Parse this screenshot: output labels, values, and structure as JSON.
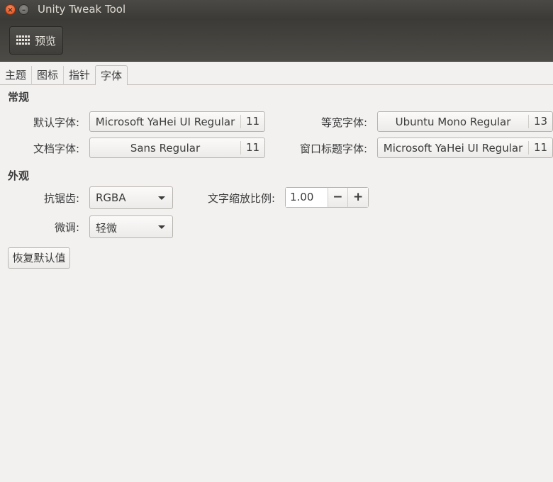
{
  "window": {
    "title": "Unity Tweak Tool",
    "close_glyph": "×",
    "minimize_glyph": "–"
  },
  "toolbar": {
    "preview_label": "预览",
    "preview_icon": "grid-icon"
  },
  "tabs": [
    {
      "label": "主题",
      "active": false
    },
    {
      "label": "图标",
      "active": false
    },
    {
      "label": "指针",
      "active": false
    },
    {
      "label": "字体",
      "active": true
    }
  ],
  "general": {
    "title": "常规",
    "default_font": {
      "label": "默认字体:",
      "name": "Microsoft YaHei UI Regular",
      "size": "11"
    },
    "monospace_font": {
      "label": "等宽字体:",
      "name": "Ubuntu Mono Regular",
      "size": "13"
    },
    "document_font": {
      "label": "文档字体:",
      "name": "Sans Regular",
      "size": "11"
    },
    "window_title_font": {
      "label": "窗口标题字体:",
      "name": "Microsoft YaHei UI Regular",
      "size": "11"
    }
  },
  "appearance": {
    "title": "外观",
    "antialiasing": {
      "label": "抗锯齿:",
      "value": "RGBA"
    },
    "text_scale": {
      "label": "文字缩放比例:",
      "value": "1.00",
      "minus": "−",
      "plus": "+"
    },
    "hinting": {
      "label": "微调:",
      "value": "轻微"
    }
  },
  "reset_label": "恢复默认值"
}
